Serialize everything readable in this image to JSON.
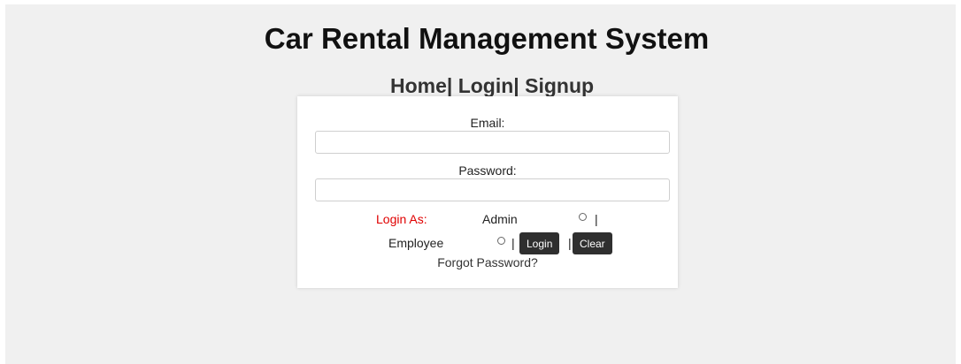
{
  "header": {
    "title": "Car Rental Management System"
  },
  "nav": {
    "home": "Home|",
    "login": "Login|",
    "signup": "Signup"
  },
  "form": {
    "email_label": "Email:",
    "email_value": "",
    "password_label": "Password:",
    "password_value": "",
    "login_as_label": "Login As:",
    "role_admin": "Admin",
    "role_employee": "Employee",
    "separator": "|",
    "login_button": "Login",
    "clear_button": "Clear",
    "forgot_link": "Forgot Password?"
  },
  "colors": {
    "background": "#f0f0f0",
    "card": "#ffffff",
    "login_as": "#e00000",
    "button": "#2f2f2f"
  }
}
